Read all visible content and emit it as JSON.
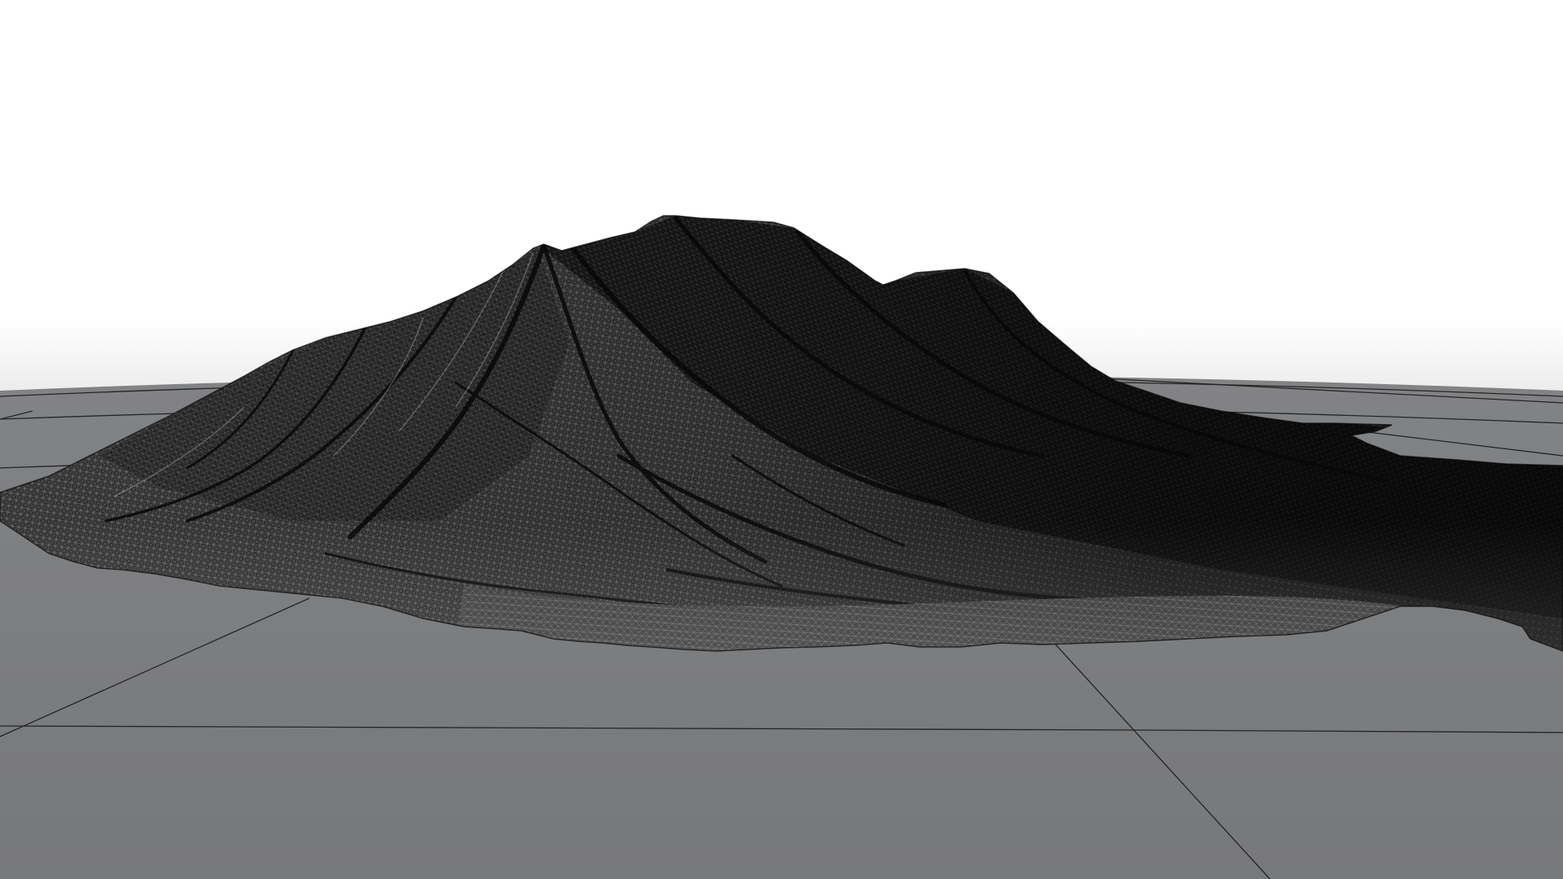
{
  "viewport": {
    "mode": "wireframe",
    "subject": "terrain-mesh"
  },
  "colors": {
    "sky_top": "#ffffff",
    "sky_horizon": "#f0f0f0",
    "ground_plane": "#7b7c7e",
    "grid_line": "#1a1a1a",
    "mesh_fill": "#2a2a2a",
    "mesh_dark": "#0f0f0f",
    "wire_light": "#bfbfbf"
  },
  "icons": {
    "grid": "ground-grid-icon",
    "mesh": "terrain-wireframe-icon"
  }
}
